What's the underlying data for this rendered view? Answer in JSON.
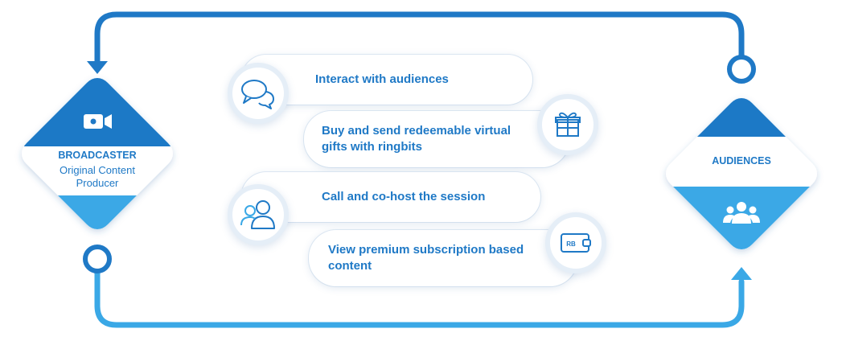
{
  "broadcaster": {
    "title": "BROADCASTER",
    "subtitle_line1": "Original Content",
    "subtitle_line2": "Producer",
    "icon": "video-camera-icon"
  },
  "audiences": {
    "title": "AUDIENCES",
    "icon": "group-users-icon"
  },
  "features": [
    {
      "label": "Interact with audiences",
      "icon": "chat-bubbles-icon"
    },
    {
      "label_line1": "Buy and send redeemable virtual",
      "label_line2": "gifts with ringbits",
      "icon": "gift-icon"
    },
    {
      "label": "Call and co-host the session",
      "icon": "users-icon"
    },
    {
      "label_line1": "View premium subscription based",
      "label_line2": "content",
      "icon": "wallet-icon",
      "icon_text": "RB"
    }
  ],
  "colors": {
    "primary": "#1f79c6",
    "light": "#3aa8e6",
    "ring": "#e5eef7"
  }
}
